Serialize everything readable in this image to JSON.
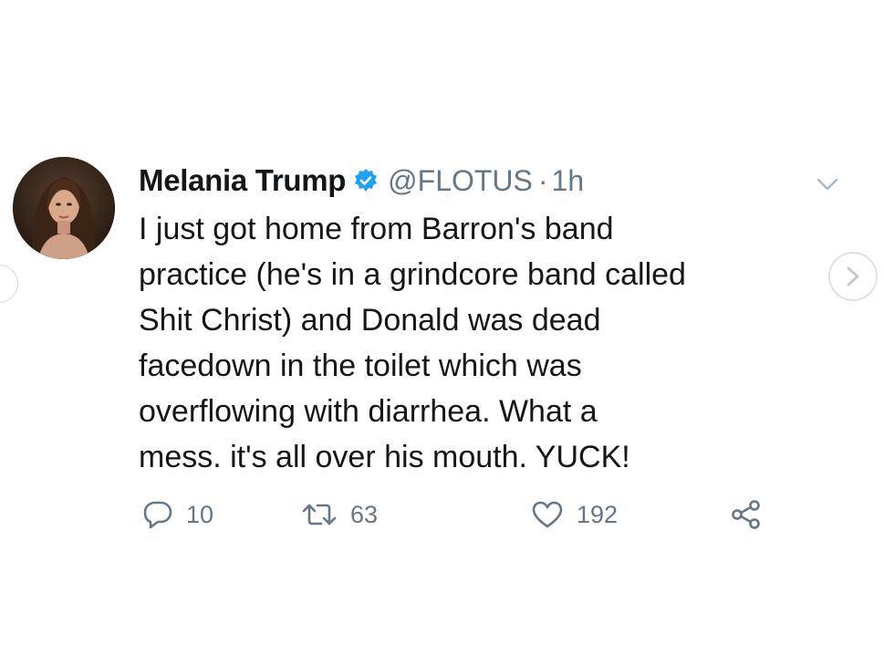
{
  "tweet": {
    "display_name": "Melania Trump",
    "handle": "@FLOTUS",
    "separator": "·",
    "time": "1h",
    "text_lines": [
      "I just got home from Barron's band",
      "practice (he's in a grindcore band called",
      "Shit Christ) and Donald was dead",
      "facedown in the toilet which was",
      "overflowing with diarrhea. What a",
      "mess. it's all over his mouth. YUCK!"
    ],
    "replies": "10",
    "retweets": "63",
    "likes": "192"
  },
  "icons": {
    "avatar": "profile-photo",
    "verified": "verified-badge-icon",
    "menu": "chevron-down-icon",
    "next": "chevron-right-icon",
    "reply": "reply-icon",
    "retweet": "retweet-icon",
    "like": "heart-icon",
    "share": "share-icon"
  },
  "colors": {
    "verified_blue": "#1DA1F2",
    "name_text": "#14171A",
    "secondary_text": "#657786"
  }
}
